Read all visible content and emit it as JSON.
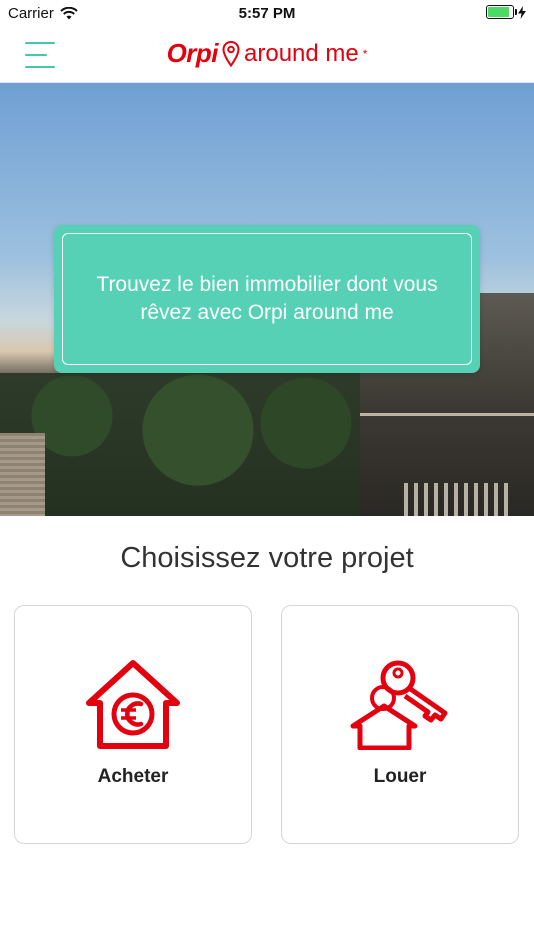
{
  "status_bar": {
    "carrier": "Carrier",
    "time": "5:57 PM"
  },
  "header": {
    "logo_brand": "Orpi",
    "logo_tagline": "around me",
    "logo_star": "*"
  },
  "hero": {
    "message": "Trouvez le bien immobilier dont vous rêvez avec Orpi around me"
  },
  "projects": {
    "title": "Choisissez votre projet",
    "options": [
      {
        "label": "Acheter",
        "icon": "house-euro-icon"
      },
      {
        "label": "Louer",
        "icon": "house-keys-icon"
      }
    ]
  },
  "colors": {
    "brand_red": "#e3000f",
    "accent_green": "#56d1b6",
    "menu_green": "#45c7aa"
  }
}
